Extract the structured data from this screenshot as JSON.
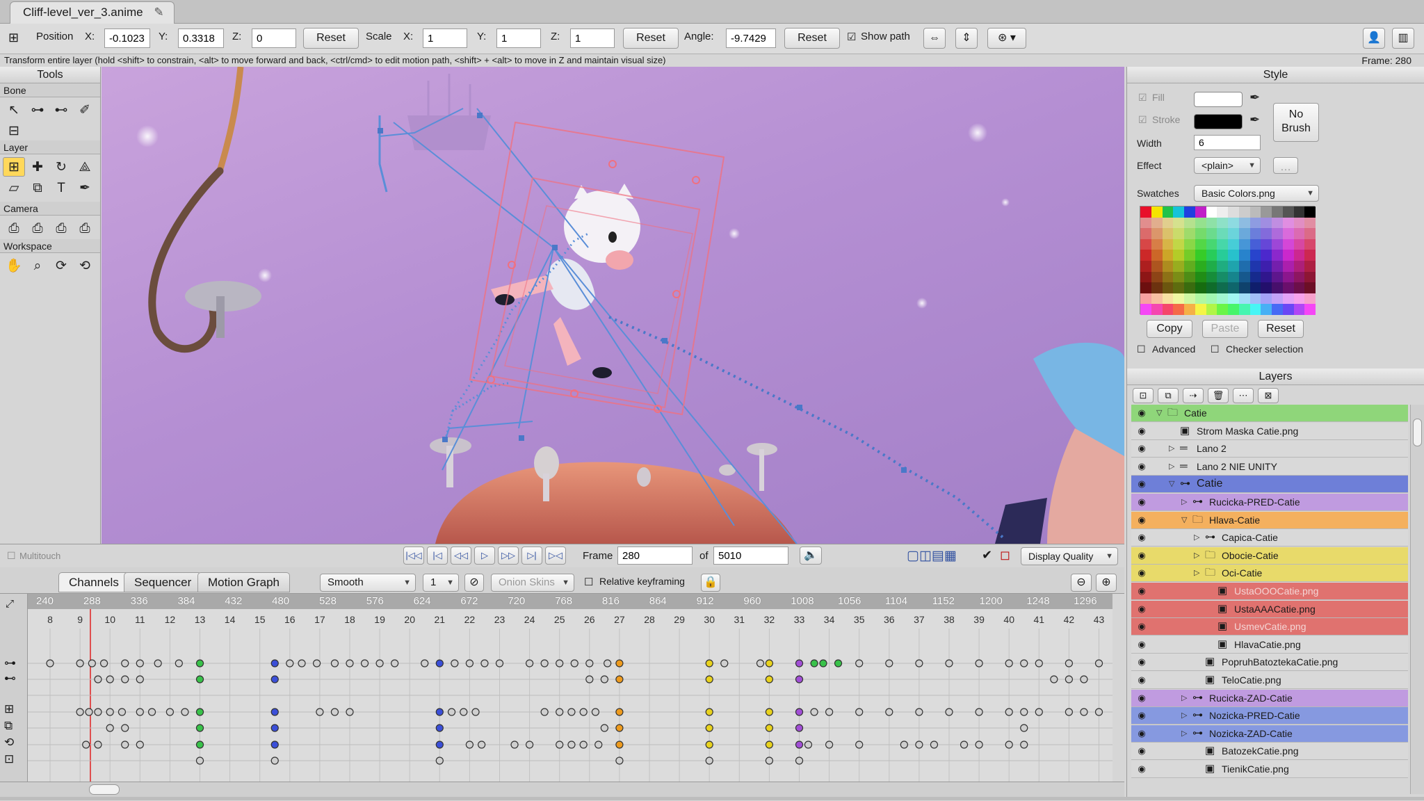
{
  "tab": {
    "title": "Cliff-level_ver_3.anime",
    "edit_icon": "pencil-icon"
  },
  "toolbar": {
    "position_label": "Position",
    "x_label": "X:",
    "x": "-0.1023",
    "y_label": "Y:",
    "y": "0.3318",
    "z_label": "Z:",
    "z": "0",
    "reset1": "Reset",
    "scale_label": "Scale",
    "sx_label": "X:",
    "sx": "1",
    "sy_label": "Y:",
    "sy": "1",
    "sz_label": "Z:",
    "sz": "1",
    "reset2": "Reset",
    "angle_label": "Angle:",
    "angle": "-9.7429",
    "reset3": "Reset",
    "show_path": "Show path"
  },
  "status": {
    "hint": "Transform entire layer (hold <shift> to constrain, <alt> to move forward and back, <ctrl/cmd> to edit motion path, <shift> + <alt> to move in Z and maintain visual size)",
    "frame": "Frame: 280"
  },
  "tools": {
    "title": "Tools",
    "sections": [
      "Bone",
      "Layer",
      "Camera",
      "Workspace"
    ]
  },
  "viewport_bar": {
    "multitouch": "Multitouch",
    "frame_label": "Frame",
    "frame": "280",
    "of_label": "of",
    "total": "5010",
    "display_quality": "Display Quality"
  },
  "timeline": {
    "tabs": [
      "Channels",
      "Sequencer",
      "Motion Graph"
    ],
    "interp": "Smooth",
    "step": "1",
    "onion": "Onion Skins",
    "relative": "Relative keyframing",
    "ruler_ticks": [
      "240",
      "288",
      "336",
      "384",
      "432",
      "480",
      "528",
      "576",
      "624",
      "672",
      "720",
      "768",
      "816",
      "864",
      "912",
      "960",
      "1008",
      "1056",
      "1104",
      "1152",
      "1200",
      "1248",
      "1296"
    ],
    "sub_ticks": [
      "8",
      "9",
      "10",
      "11",
      "12",
      "13",
      "14",
      "15",
      "16",
      "17",
      "18",
      "19",
      "20",
      "21",
      "22",
      "23",
      "24",
      "25",
      "26",
      "27",
      "28",
      "29",
      "30",
      "31",
      "32",
      "33",
      "34",
      "35",
      "36",
      "37",
      "38",
      "39",
      "40",
      "41",
      "42",
      "43"
    ],
    "current_frame": 280
  },
  "style": {
    "title": "Style",
    "fill": "Fill",
    "stroke": "Stroke",
    "width_label": "Width",
    "width": "6",
    "effect_label": "Effect",
    "effect": "<plain>",
    "no_brush": "No Brush",
    "swatches_label": "Swatches",
    "swatches": "Basic Colors.png",
    "copy": "Copy",
    "paste": "Paste",
    "reset": "Reset",
    "advanced": "Advanced",
    "checker": "Checker selection",
    "fill_color": "#ffffff",
    "stroke_color": "#000000"
  },
  "layers": {
    "title": "Layers",
    "items": [
      {
        "name": "Catie",
        "depth": 0,
        "type": "folder",
        "open": true,
        "color": "#8fd67a"
      },
      {
        "name": "Strom Maska Catie.png",
        "depth": 1,
        "type": "image",
        "open": null,
        "color": "#d9d9d9"
      },
      {
        "name": "Lano 2",
        "depth": 1,
        "type": "vector",
        "open": false,
        "color": "#d9d9d9"
      },
      {
        "name": "Lano 2 NIE UNITY",
        "depth": 1,
        "type": "vector",
        "open": false,
        "color": "#d9d9d9"
      },
      {
        "name": "Catie",
        "depth": 1,
        "type": "bone",
        "open": true,
        "color": "#6e7fd8"
      },
      {
        "name": "Rucicka-PRED-Catie",
        "depth": 2,
        "type": "bone",
        "open": false,
        "color": "#c09be0"
      },
      {
        "name": "Hlava-Catie",
        "depth": 2,
        "type": "folder",
        "open": true,
        "color": "#f4b05e"
      },
      {
        "name": "Capica-Catie",
        "depth": 3,
        "type": "bone",
        "open": false,
        "color": "#d9d9d9"
      },
      {
        "name": "Obocie-Catie",
        "depth": 3,
        "type": "folder",
        "open": false,
        "color": "#e8da6a"
      },
      {
        "name": "Oci-Catie",
        "depth": 3,
        "type": "folder",
        "open": false,
        "color": "#e8da6a"
      },
      {
        "name": "UstaOOOCatie.png",
        "depth": 4,
        "type": "image",
        "open": null,
        "color": "#e0726f"
      },
      {
        "name": "UstaAAACatie.png",
        "depth": 4,
        "type": "image",
        "open": null,
        "color": "#e0726f"
      },
      {
        "name": "UsmevCatie.png",
        "depth": 4,
        "type": "image",
        "open": null,
        "color": "#e0726f"
      },
      {
        "name": "HlavaCatie.png",
        "depth": 4,
        "type": "image",
        "open": null,
        "color": "#d9d9d9"
      },
      {
        "name": "PopruhBatoztekaCatie.png",
        "depth": 3,
        "type": "image",
        "open": null,
        "color": "#d9d9d9"
      },
      {
        "name": "TeloCatie.png",
        "depth": 3,
        "type": "image",
        "open": null,
        "color": "#d9d9d9"
      },
      {
        "name": "Rucicka-ZAD-Catie",
        "depth": 2,
        "type": "bone",
        "open": false,
        "color": "#c09be0"
      },
      {
        "name": "Nozicka-PRED-Catie",
        "depth": 2,
        "type": "bone",
        "open": false,
        "color": "#8699e0"
      },
      {
        "name": "Nozicka-ZAD-Catie",
        "depth": 2,
        "type": "bone",
        "open": false,
        "color": "#8699e0"
      },
      {
        "name": "BatozekCatie.png",
        "depth": 3,
        "type": "image",
        "open": null,
        "color": "#d9d9d9"
      },
      {
        "name": "TienikCatie.png",
        "depth": 3,
        "type": "image",
        "open": null,
        "color": "#d9d9d9"
      }
    ]
  },
  "keyframe_rows": [
    {
      "row": 0,
      "keys": [
        [
          8,
          "g"
        ],
        [
          9,
          "g"
        ],
        [
          9.4,
          "g"
        ],
        [
          9.8,
          "g"
        ],
        [
          10.5,
          "g"
        ],
        [
          11,
          "g"
        ],
        [
          11.6,
          "g"
        ],
        [
          12.3,
          "g"
        ],
        [
          13,
          "green"
        ],
        [
          15.5,
          "blue"
        ],
        [
          16,
          "g"
        ],
        [
          16.4,
          "g"
        ],
        [
          16.9,
          "g"
        ],
        [
          17.5,
          "g"
        ],
        [
          18,
          "g"
        ],
        [
          18.5,
          "g"
        ],
        [
          19,
          "g"
        ],
        [
          19.5,
          "g"
        ],
        [
          20.5,
          "g"
        ],
        [
          21,
          "blue"
        ],
        [
          21.5,
          "g"
        ],
        [
          22,
          "g"
        ],
        [
          22.5,
          "g"
        ],
        [
          23,
          "g"
        ],
        [
          24,
          "g"
        ],
        [
          24.5,
          "g"
        ],
        [
          25,
          "g"
        ],
        [
          25.5,
          "g"
        ],
        [
          26,
          "g"
        ],
        [
          26.6,
          "g"
        ],
        [
          27,
          "orange"
        ],
        [
          30,
          "yellow"
        ],
        [
          30.5,
          "g"
        ],
        [
          31.7,
          "g"
        ],
        [
          32,
          "yellow"
        ],
        [
          33,
          "purple"
        ],
        [
          33.5,
          "green"
        ],
        [
          33.8,
          "green"
        ],
        [
          34.3,
          "green"
        ],
        [
          35,
          "g"
        ],
        [
          36,
          "g"
        ],
        [
          37,
          "g"
        ],
        [
          38,
          "g"
        ],
        [
          39,
          "g"
        ],
        [
          40,
          "g"
        ],
        [
          40.5,
          "g"
        ],
        [
          41,
          "g"
        ],
        [
          42,
          "g"
        ],
        [
          43,
          "g"
        ]
      ]
    },
    {
      "row": 1,
      "keys": [
        [
          9.6,
          "g"
        ],
        [
          10,
          "g"
        ],
        [
          10.5,
          "g"
        ],
        [
          11,
          "g"
        ],
        [
          13,
          "green"
        ],
        [
          15.5,
          "blue"
        ],
        [
          26,
          "g"
        ],
        [
          26.5,
          "g"
        ],
        [
          27,
          "orange"
        ],
        [
          30,
          "yellow"
        ],
        [
          32,
          "yellow"
        ],
        [
          33,
          "purple"
        ],
        [
          41.5,
          "g"
        ],
        [
          42,
          "g"
        ],
        [
          42.5,
          "g"
        ]
      ]
    },
    {
      "row": 3,
      "keys": [
        [
          9,
          "g"
        ],
        [
          9.3,
          "g"
        ],
        [
          9.6,
          "g"
        ],
        [
          10,
          "g"
        ],
        [
          10.4,
          "g"
        ],
        [
          11,
          "g"
        ],
        [
          11.4,
          "g"
        ],
        [
          12,
          "g"
        ],
        [
          12.5,
          "g"
        ],
        [
          13,
          "green"
        ],
        [
          15.5,
          "blue"
        ],
        [
          17,
          "g"
        ],
        [
          17.5,
          "g"
        ],
        [
          18,
          "g"
        ],
        [
          21,
          "blue"
        ],
        [
          21.4,
          "g"
        ],
        [
          21.8,
          "g"
        ],
        [
          22.2,
          "g"
        ],
        [
          24.5,
          "g"
        ],
        [
          25,
          "g"
        ],
        [
          25.4,
          "g"
        ],
        [
          25.8,
          "g"
        ],
        [
          26.2,
          "g"
        ],
        [
          27,
          "orange"
        ],
        [
          30,
          "yellow"
        ],
        [
          32,
          "yellow"
        ],
        [
          33,
          "purple"
        ],
        [
          33.5,
          "g"
        ],
        [
          34,
          "g"
        ],
        [
          35,
          "g"
        ],
        [
          36,
          "g"
        ],
        [
          37,
          "g"
        ],
        [
          38,
          "g"
        ],
        [
          39,
          "g"
        ],
        [
          40,
          "g"
        ],
        [
          40.5,
          "g"
        ],
        [
          41,
          "g"
        ],
        [
          42,
          "g"
        ],
        [
          42.5,
          "g"
        ],
        [
          43,
          "g"
        ]
      ]
    },
    {
      "row": 4,
      "keys": [
        [
          10,
          "g"
        ],
        [
          10.5,
          "g"
        ],
        [
          13,
          "green"
        ],
        [
          15.5,
          "blue"
        ],
        [
          21,
          "blue"
        ],
        [
          26.5,
          "g"
        ],
        [
          27,
          "orange"
        ],
        [
          30,
          "yellow"
        ],
        [
          32,
          "yellow"
        ],
        [
          33,
          "purple"
        ],
        [
          40.5,
          "g"
        ]
      ]
    },
    {
      "row": 5,
      "keys": [
        [
          9.2,
          "g"
        ],
        [
          9.6,
          "g"
        ],
        [
          10.5,
          "g"
        ],
        [
          11,
          "g"
        ],
        [
          13,
          "green"
        ],
        [
          15.5,
          "blue"
        ],
        [
          21,
          "blue"
        ],
        [
          22,
          "g"
        ],
        [
          22.4,
          "g"
        ],
        [
          23.5,
          "g"
        ],
        [
          24,
          "g"
        ],
        [
          25,
          "g"
        ],
        [
          25.4,
          "g"
        ],
        [
          25.8,
          "g"
        ],
        [
          26.3,
          "g"
        ],
        [
          27,
          "orange"
        ],
        [
          30,
          "yellow"
        ],
        [
          32,
          "yellow"
        ],
        [
          33,
          "purple"
        ],
        [
          33.3,
          "g"
        ],
        [
          34,
          "g"
        ],
        [
          35,
          "g"
        ],
        [
          36.5,
          "g"
        ],
        [
          37,
          "g"
        ],
        [
          37.5,
          "g"
        ],
        [
          38.5,
          "g"
        ],
        [
          39,
          "g"
        ],
        [
          40,
          "g"
        ],
        [
          40.5,
          "g"
        ]
      ]
    },
    {
      "row": 6,
      "keys": [
        [
          13,
          "g"
        ],
        [
          15.5,
          "g"
        ],
        [
          21,
          "g"
        ],
        [
          27,
          "g"
        ],
        [
          30,
          "g"
        ],
        [
          32,
          "g"
        ],
        [
          33,
          "g"
        ]
      ]
    }
  ]
}
